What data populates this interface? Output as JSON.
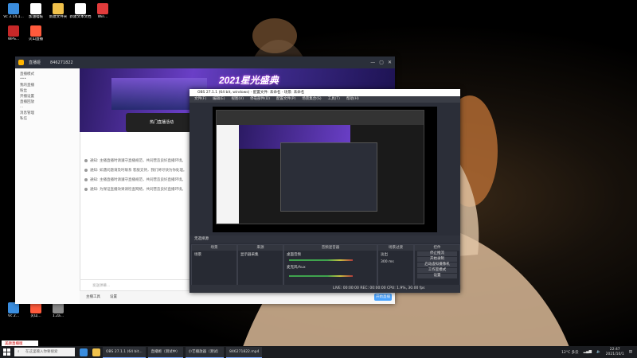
{
  "desktop_icons": [
    {
      "label": "Vc 3.14.1...",
      "color": "#3a8dde"
    },
    {
      "label": "加油稽核",
      "color": "#ffffff"
    },
    {
      "label": "新建文件夹",
      "color": "#f0c14b"
    },
    {
      "label": "新建文本文档",
      "color": "#ffffff"
    },
    {
      "label": "Win...",
      "color": "#e23b3b"
    },
    {
      "label": "WPS...",
      "color": "#c62828"
    },
    {
      "label": "火山直播",
      "color": "#ff5a3c"
    },
    {
      "label": "Vc 2...",
      "color": "#3a8dde"
    },
    {
      "label": "火山...",
      "color": "#ff5a3c"
    },
    {
      "label": "1.2a...",
      "color": "#8b8b8b"
    }
  ],
  "live_window": {
    "title": "直播姬",
    "room_id": "846271822",
    "banner_title": "2021星光盛典",
    "banner_card": "热门直播活动",
    "sidebar_rows": [
      "直播模式",
      "•••",
      "我的直播",
      "粉丝",
      "开播设置",
      "直播回放",
      "...",
      "消息管理",
      "私信"
    ],
    "system_messages": [
      "通知: 主播直播时请遵守直播规范，共同营造良好直播环境。",
      "通知: 如遇问题请及时联系 客服支持，我们将尽快为你处理。",
      "通知: 主播直播时请遵守直播规范，共同营造良好直播环境。",
      "通知: 为保证直播效果请检查网络，共同营造良好直播环境。"
    ],
    "input_placeholder": "发送弹幕...",
    "bottom_items": [
      "主播工具",
      "设置"
    ],
    "start_button": "开始直播"
  },
  "obs": {
    "title": "OBS 27.1.1 (64 bit, windows) - 配置文件: 未命名 - 场景: 未命名",
    "menu": [
      "文件(F)",
      "编辑(E)",
      "视图(V)",
      "停靠部件(D)",
      "配置文件(P)",
      "场景集合(S)",
      "工具(T)",
      "帮助(H)"
    ],
    "source_toolbar": "无选择源",
    "panels": {
      "scenes": {
        "header": "场景",
        "item": "场景"
      },
      "sources": {
        "header": "来源",
        "item": "显示器采集"
      },
      "mixer": {
        "header": "音频混音器",
        "tracks": [
          "桌面音频",
          "麦克风/Aux"
        ],
        "level": "0.0 dB"
      },
      "transitions": {
        "header": "场景过渡",
        "type": "淡出",
        "duration": "300 ms"
      },
      "controls": {
        "header": "控件",
        "buttons": [
          "停止推流",
          "开始录制",
          "启动虚拟摄像机",
          "工作室模式",
          "设置",
          "退出"
        ]
      }
    },
    "status": "LIVE: 00:00:00   REC: 00:00:00   CPU: 1.9%, 30.00 fps"
  },
  "taskbar": {
    "search_placeholder": "在这里输入你要搜索",
    "apps": [
      "OBS 27.1.1 (64 bit...",
      "直播姬（测试中）",
      "小艺播放器（测试）",
      "846271822.mp4"
    ],
    "tray_text": "12°C 多云",
    "time": "22:47",
    "date": "2021/10/1"
  },
  "notification": "美颜直播版",
  "accent_colors": {
    "taskbar": "#1b1d21",
    "obs_bg": "#2b2e38",
    "banner": "#6a3fc7",
    "live_button": "#4aa3ff"
  }
}
